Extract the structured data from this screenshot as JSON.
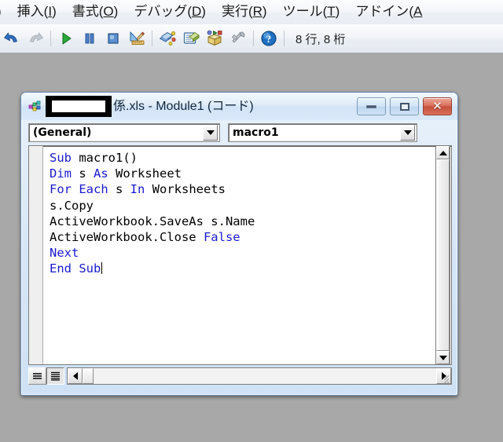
{
  "app": {
    "menubar": {
      "items": [
        {
          "label": ")",
          "accel": "",
          "partial": true,
          "name": "menu-edit-partial"
        },
        {
          "label": "挿入",
          "accel": "I",
          "name": "menu-insert"
        },
        {
          "label": "書式",
          "accel": "O",
          "name": "menu-format"
        },
        {
          "label": "デバッグ",
          "accel": "D",
          "name": "menu-debug"
        },
        {
          "label": "実行",
          "accel": "R",
          "name": "menu-run"
        },
        {
          "label": "ツール",
          "accel": "T",
          "name": "menu-tools"
        },
        {
          "label": "アドイン",
          "accel": "A",
          "name": "menu-addins",
          "clipped": true
        }
      ]
    },
    "toolbar": {
      "buttons": [
        {
          "name": "undo-icon",
          "title": "元に戻す"
        },
        {
          "name": "redo-icon",
          "title": "やり直し"
        },
        {
          "name": "run-icon",
          "title": "Sub/ユーザー フォームの実行"
        },
        {
          "name": "pause-icon",
          "title": "中断"
        },
        {
          "name": "stop-icon",
          "title": "リセット"
        },
        {
          "name": "design-mode-icon",
          "title": "デザイン モード"
        },
        {
          "name": "project-explorer-icon",
          "title": "プロジェクト エクスプローラー"
        },
        {
          "name": "properties-window-icon",
          "title": "プロパティ ウィンドウ"
        },
        {
          "name": "object-browser-icon",
          "title": "オブジェクト ブラウザー"
        },
        {
          "name": "toolbox-icon",
          "title": "ツールボックス"
        },
        {
          "name": "help-icon",
          "title": "ヘルプ"
        }
      ],
      "position_indicator": "8 行, 8 桁"
    },
    "code_window": {
      "title_redacted": true,
      "title_suffix": "係.xls - Module1 (コード)",
      "icon": "module-icon",
      "caption_buttons": {
        "minimize": "—",
        "restore": "❐",
        "close": "✕"
      },
      "object_combo": {
        "value": "(General)",
        "name": "object-combo"
      },
      "procedure_combo": {
        "value": "macro1",
        "name": "procedure-combo"
      },
      "code_lines": [
        {
          "indent": 0,
          "tokens": [
            {
              "t": "Sub",
              "kw": true
            },
            {
              "t": " macro1()",
              "kw": false
            }
          ]
        },
        {
          "indent": 0,
          "tokens": [
            {
              "t": "Dim",
              "kw": true
            },
            {
              "t": " s ",
              "kw": false
            },
            {
              "t": "As",
              "kw": true
            },
            {
              "t": " Worksheet",
              "kw": false
            }
          ]
        },
        {
          "indent": 0,
          "tokens": [
            {
              "t": "For Each",
              "kw": true
            },
            {
              "t": " s ",
              "kw": false
            },
            {
              "t": "In",
              "kw": true
            },
            {
              "t": " Worksheets",
              "kw": false
            }
          ]
        },
        {
          "indent": 0,
          "tokens": [
            {
              "t": "s.Copy",
              "kw": false
            }
          ]
        },
        {
          "indent": 0,
          "tokens": [
            {
              "t": "ActiveWorkbook.SaveAs s.Name",
              "kw": false
            }
          ]
        },
        {
          "indent": 0,
          "tokens": [
            {
              "t": "ActiveWorkbook.Close ",
              "kw": false
            },
            {
              "t": "False",
              "kw": true
            }
          ]
        },
        {
          "indent": 0,
          "tokens": [
            {
              "t": "Next",
              "kw": true
            }
          ]
        },
        {
          "indent": 0,
          "tokens": [
            {
              "t": "End Sub",
              "kw": true
            }
          ],
          "caret": true
        }
      ],
      "view_buttons": {
        "procedure_view": "procedure-view-button",
        "full_module_view": "full-module-view-button",
        "selected": "full_module_view"
      }
    },
    "colors": {
      "keyword": "#1a1ad0",
      "code_text": "#000000",
      "mdi_background": "#a8a8a8",
      "title_gradient_top": "#f3f8fd",
      "close_button": "#c4503c"
    }
  }
}
